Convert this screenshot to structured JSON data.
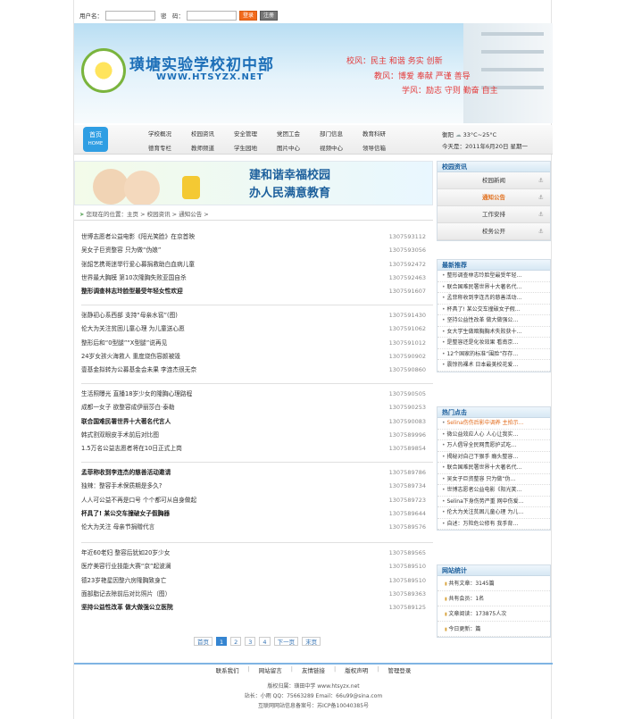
{
  "login": {
    "user_label": "用户名：",
    "pass_label": "密　码：",
    "login_btn": "登录",
    "reg_btn": "注册"
  },
  "banner": {
    "school_name": "璜塘实验学校初中部",
    "url": "WWW.HTSYZX.NET",
    "motto1": "校风：民主 和谐 务实 创新",
    "motto2": "教风：博爱 奉献 严谨 善导",
    "motto3": "学风：励志 守则 勤奋 自主"
  },
  "nav": {
    "home_label": "首页",
    "home_sub": "HOME",
    "items": [
      "学校概况",
      "校园资讯",
      "安全管理",
      "党团工会",
      "部门信息",
      "教育科研",
      "德育专栏",
      "教师频道",
      "学生园地",
      "图片中心",
      "视频中心",
      "领导信箱"
    ]
  },
  "weather": {
    "city": "衡阳",
    "temp": "33°C~25°C",
    "date": "今天是：2011年6月20日 星期一"
  },
  "ad": {
    "line1": "建和谐幸福校园",
    "line2": "办人民满意教育"
  },
  "breadcrumb": "您现在的位置：主页 > 校园资讯 > 通知公告 >",
  "news_groups": [
    [
      {
        "t": "世博志愿者公益电影《阳光笑脸》在京首映",
        "d": "1307593112",
        "b": false
      },
      {
        "t": "吴女子巨资整容 只为做“伪娘”",
        "d": "1307593056",
        "b": false
      },
      {
        "t": "张韶艺携哥迷举行爱心募捐救助白血病儿童",
        "d": "1307592472",
        "b": false
      },
      {
        "t": "世界最大胸模 第10次隆胸失败亚国自杀",
        "d": "1307592463",
        "b": false
      },
      {
        "t": "整形调查林志玲脸型最受年轻女性欢迎",
        "d": "1307591607",
        "b": true
      }
    ],
    [
      {
        "t": "张静初心系西部 支持“母亲水窖”(图)",
        "d": "1307591430",
        "b": false
      },
      {
        "t": "伦大为关注贫困儿童心理 为儿童送心愿",
        "d": "1307591062",
        "b": false
      },
      {
        "t": "整形后和“0型腿”“X型腿”说再见",
        "d": "1307591012",
        "b": false
      },
      {
        "t": "24岁女孩火海救人 重度烧伤容颜被毁",
        "d": "1307590902",
        "b": false
      },
      {
        "t": "壹基金拟转为公募基金会未果 李连杰很无奈",
        "d": "1307590860",
        "b": false
      }
    ],
    [
      {
        "t": "生活照曝光 直播18岁少女的隆胸心理路程",
        "d": "1307590505",
        "b": false
      },
      {
        "t": "成都一女子 欲整容成伊丽莎白·泰勒",
        "d": "1307590253",
        "b": false
      },
      {
        "t": "联合国难民署世界十大著名代言人",
        "d": "1307590083",
        "b": true
      },
      {
        "t": "韩式割双眼皮手术前后对比图",
        "d": "1307589996",
        "b": false
      },
      {
        "t": "1.5万名公益志愿者将在10日正式上岗",
        "d": "1307589854",
        "b": false
      }
    ],
    [
      {
        "t": "孟菲称收到李连杰的慈善活动邀请",
        "d": "1307589786",
        "b": true
      },
      {
        "t": "独辣：整容手术保质期是多久?",
        "d": "1307589734",
        "b": false
      },
      {
        "t": "人人可公益不再是口号 个个都可从自身做起",
        "d": "1307589723",
        "b": false
      },
      {
        "t": "杯具了! 某公交车撞破女子假胸器",
        "d": "1307589644",
        "b": true
      },
      {
        "t": "伦大为关注 母亲节捐赠代言",
        "d": "1307589576",
        "b": false
      }
    ],
    [
      {
        "t": "年近60老妇 整容后犹如20岁少女",
        "d": "1307589565",
        "b": false
      },
      {
        "t": "医疗美容行业技能大赛“京”起波澜",
        "d": "1307589510",
        "b": false
      },
      {
        "t": "德23岁艳星因整六房隆胸致身亡",
        "d": "1307589510",
        "b": false
      },
      {
        "t": "面部脂记去除前后对比照片（图）",
        "d": "1307589363",
        "b": false
      },
      {
        "t": "坚持公益性改革 做大做强公立医院",
        "d": "1307589125",
        "b": true
      }
    ]
  ],
  "pager": {
    "first": "首页",
    "pages": [
      "1",
      "2",
      "3",
      "4"
    ],
    "next": "下一页",
    "last": "末页"
  },
  "side": {
    "news_title": "校园资讯",
    "news_items": [
      "校园新闻",
      "通知公告",
      "工作安排",
      "校务公开"
    ],
    "rec_title": "最新推荐",
    "rec_items": [
      "整形调查林志玲脸型最受年轻…",
      "联合国难民署世界十大著名代…",
      "孟菲称收到李连杰的慈善活动…",
      "杯具了! 某公交车撞破女子假…",
      "坚持公益性改革 做大做强公…",
      "女大学生做暗胸胸术失败获十…",
      "是整容还是化妆效果 看南京…",
      "12个国家的标准“围脸”存存…",
      "震惊热裸术 日本最美校花爱…"
    ],
    "hot_title": "热门点击",
    "hot_items": [
      "Selina伤伤后影中调养 主拍示…",
      "微公益效应人心 人心让我实…",
      "万人倡导全民网责愿护式吃…",
      "揭秘对自己下狠手 瘾头整容…",
      "联合国难民署世界十大著名代…",
      "吴女子巨资整容 只为做“伪…",
      "世博志愿者公益电影《阳光笑…",
      "Selina下身伤势严重 网中伤爱…",
      "伦大为关注贫困儿童心理 为儿…",
      "自述：万险危公修有 我手背…"
    ],
    "stat_title": "网站统计",
    "stat_items": [
      "共有文章：3145篇",
      "共有会员：1名",
      "文章阅读：173875人次",
      "今日更新：篇"
    ]
  },
  "footer": {
    "links": [
      "联系我们",
      "网站留言",
      "友情链接",
      "版权声明",
      "管理登录"
    ],
    "line1": "版权归属：璜田中学 www.htsyzx.net",
    "line2": "站长：小雨 QQ：75663289 Email：66u99@sina.com",
    "line3": "互联网网站信息备案号：苏ICP备10040385号"
  }
}
